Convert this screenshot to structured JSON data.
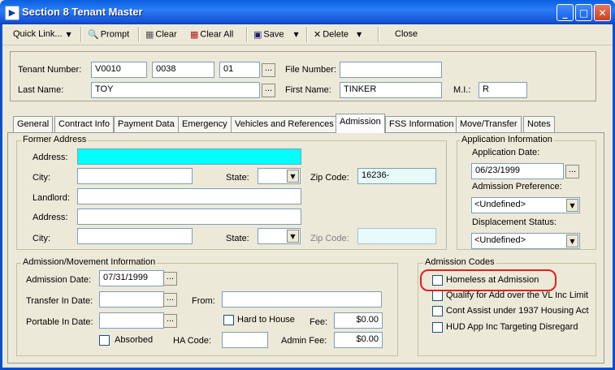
{
  "window": {
    "title": "Section 8 Tenant Master",
    "icon": "window-app-icon"
  },
  "toolbar": {
    "quick_link": "Quick Link...",
    "prompt": "Prompt",
    "clear": "Clear",
    "clear_all": "Clear All",
    "save": "Save",
    "delete": "Delete",
    "close": "Close"
  },
  "header": {
    "tenant_number_label": "Tenant Number:",
    "tenant_number_1": "V0010",
    "tenant_number_2": "0038",
    "tenant_number_3": "01",
    "file_number_label": "File Number:",
    "file_number": "",
    "last_name_label": "Last Name:",
    "last_name": "TOY",
    "first_name_label": "First Name:",
    "first_name": "TINKER",
    "mi_label": "M.I.:",
    "mi": "R",
    "ellipsis": "..."
  },
  "tabs": [
    "General",
    "Contract Info",
    "Payment Data",
    "Emergency",
    "Vehicles and References",
    "Admission",
    "FSS Information",
    "Move/Transfer",
    "Notes"
  ],
  "former_address": {
    "title": "Former Address",
    "address_label": "Address:",
    "address": "",
    "city_label": "City:",
    "city": "",
    "state_label": "State:",
    "state": "",
    "zip_label": "Zip Code:",
    "zip": "16236-",
    "landlord_label": "Landlord:",
    "landlord": "",
    "address2_label": "Address:",
    "address2": "",
    "city2_label": "City:",
    "city2": "",
    "state2_label": "State:",
    "state2": "",
    "zip2_label": "Zip Code:",
    "zip2": ""
  },
  "application": {
    "title": "Application Information",
    "date_label": "Application Date:",
    "date": "06/23/1999",
    "pref_label": "Admission Preference:",
    "pref": "<Undefined>",
    "disp_label": "Displacement Status:",
    "disp": "<Undefined>"
  },
  "admission": {
    "title": "Admission/Movement Information",
    "date_label": "Admission Date:",
    "date": "07/31/1999",
    "transfer_label": "Transfer In Date:",
    "transfer": "",
    "from_label": "From:",
    "from": "",
    "portable_label": "Portable In Date:",
    "portable": "",
    "hard_label": "Hard to House",
    "fee_label": "Fee:",
    "fee": "$0.00",
    "absorbed_label": "Absorbed",
    "ha_code_label": "HA Code:",
    "ha_code": "",
    "admin_fee_label": "Admin Fee:",
    "admin_fee": "$0.00"
  },
  "codes": {
    "title": "Admission Codes",
    "items": [
      "Homeless at Admission",
      "Qualify for Add over the VL Inc Limit",
      "Cont Assist under 1937 Housing Act",
      "HUD App Inc Targeting Disregard"
    ]
  },
  "colors": {
    "title_bar": "#1553d6",
    "highlight": "#e02020",
    "address_fill": "#00ffff",
    "zip_fill": "#e8fbfb"
  }
}
